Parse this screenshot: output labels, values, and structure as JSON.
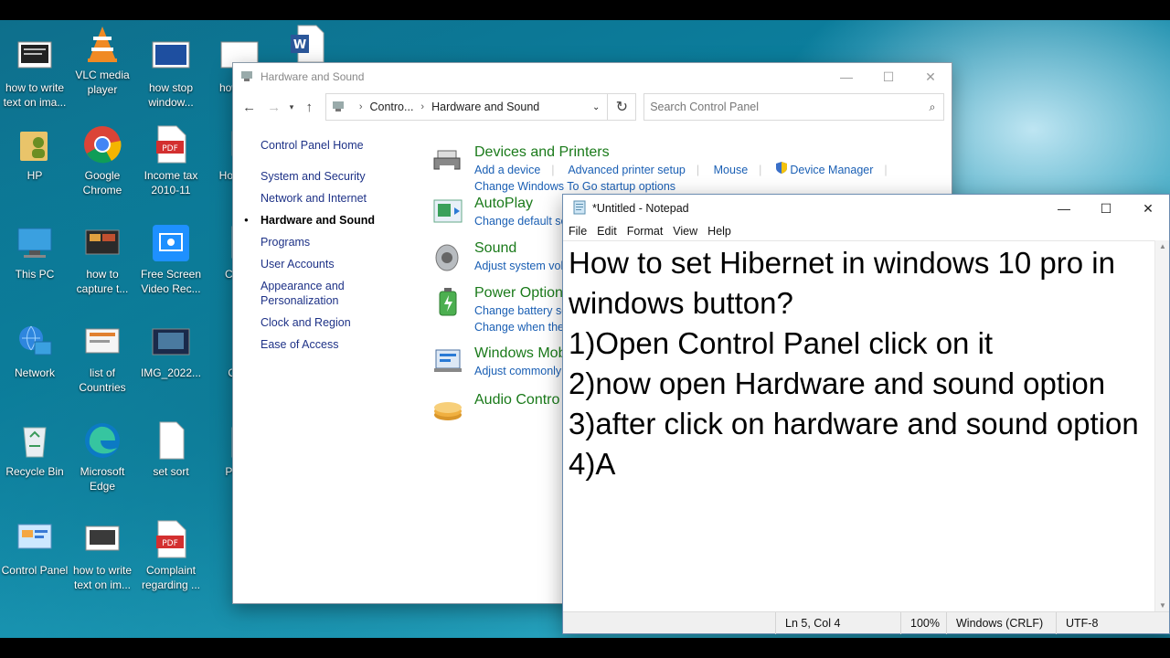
{
  "desktop": {
    "icons": [
      {
        "label": "how to write text on ima...",
        "icon": "image-file-icon"
      },
      {
        "label": "VLC media player",
        "icon": "vlc-icon"
      },
      {
        "label": "how stop window...",
        "icon": "image-file-icon"
      },
      {
        "label": "how filte",
        "icon": "image-file-icon"
      },
      {
        "label": "",
        "icon": "word-document-icon"
      },
      {
        "label": "HP",
        "icon": "user-folder-icon"
      },
      {
        "label": "Google Chrome",
        "icon": "chrome-icon"
      },
      {
        "label": "Income tax 2010-11",
        "icon": "pdf-icon"
      },
      {
        "label": "Ho wrap",
        "icon": "image-file-icon"
      },
      {
        "label": "This PC",
        "icon": "computer-icon"
      },
      {
        "label": "how to capture t...",
        "icon": "image-file-icon"
      },
      {
        "label": "Free Screen Video Rec...",
        "icon": "screen-recorder-icon"
      },
      {
        "label": "Ch bu",
        "icon": "word-document-icon"
      },
      {
        "label": "Network",
        "icon": "network-icon"
      },
      {
        "label": "list of Countries",
        "icon": "image-file-icon"
      },
      {
        "label": "IMG_2022...",
        "icon": "image-file-icon"
      },
      {
        "label": "OBS",
        "icon": "obs-icon"
      },
      {
        "label": "Recycle Bin",
        "icon": "recycle-bin-icon"
      },
      {
        "label": "Microsoft Edge",
        "icon": "edge-icon"
      },
      {
        "label": "set sort",
        "icon": "text-file-icon"
      },
      {
        "label": "Prese",
        "icon": "text-file-icon"
      },
      {
        "label": "Control Panel",
        "icon": "control-panel-icon"
      },
      {
        "label": "how to write text on im...",
        "icon": "image-file-icon"
      },
      {
        "label": "Complaint regarding ...",
        "icon": "pdf-icon"
      }
    ]
  },
  "control_panel": {
    "title": "Hardware and Sound",
    "address": {
      "crumb1": "Contro...",
      "crumb2": "Hardware and Sound"
    },
    "search_placeholder": "Search Control Panel",
    "left_nav": [
      {
        "label": "Control Panel Home"
      },
      {
        "label": "System and Security"
      },
      {
        "label": "Network and Internet"
      },
      {
        "label": "Hardware and Sound",
        "active": true
      },
      {
        "label": "Programs"
      },
      {
        "label": "User Accounts"
      },
      {
        "label": "Appearance and Personalization"
      },
      {
        "label": "Clock and Region"
      },
      {
        "label": "Ease of Access"
      }
    ],
    "categories": [
      {
        "title": "Devices and Printers",
        "links": [
          "Add a device",
          "Advanced printer setup",
          "Mouse",
          "Device Manager"
        ],
        "links2": [
          "Change Windows To Go startup options"
        ]
      },
      {
        "title": "AutoPlay",
        "links": [
          "Change default set"
        ],
        "links2": []
      },
      {
        "title": "Sound",
        "links": [
          "Adjust system volu"
        ],
        "links2": []
      },
      {
        "title": "Power Option",
        "links": [
          "Change battery set"
        ],
        "links2": [
          "Change when the c"
        ]
      },
      {
        "title": "Windows Mob",
        "links": [
          "Adjust commonly"
        ],
        "links2": []
      },
      {
        "title": "Audio Contro",
        "links": [],
        "links2": []
      }
    ]
  },
  "notepad": {
    "title": "*Untitled - Notepad",
    "menu": [
      "File",
      "Edit",
      "Format",
      "View",
      "Help"
    ],
    "text": "How to set Hibernet in windows 10 pro in windows button?\n1)Open Control Panel click on it\n2)now open Hardware and sound option\n3)after click on hardware and sound option\n4)A",
    "status": {
      "position": "Ln 5, Col 4",
      "zoom": "100%",
      "line_ending": "Windows (CRLF)",
      "encoding": "UTF-8"
    }
  }
}
